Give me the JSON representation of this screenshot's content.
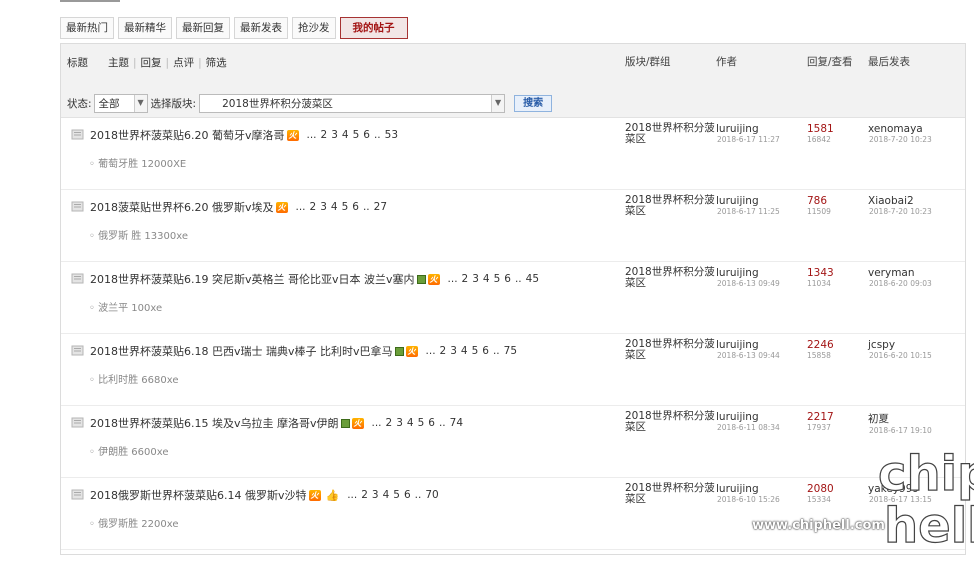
{
  "tabs": [
    "最新热门",
    "最新精华",
    "最新回复",
    "最新发表",
    "抢沙发",
    "我的帖子"
  ],
  "active_tab_index": 5,
  "header": {
    "filters": [
      "标题",
      "主题",
      "回复",
      "点评",
      "筛选"
    ],
    "col_forum": "版块/群组",
    "col_author": "作者",
    "col_stats": "回复/查看",
    "col_last": "最后发表"
  },
  "form": {
    "status_label": "状态:",
    "status_value": "全部",
    "forum_label": "选择版块:",
    "forum_value": "2018世界杯积分菠菜区",
    "search_label": "搜索"
  },
  "threads": [
    {
      "title": "2018世界杯菠菜贴6.20 葡萄牙v摩洛哥",
      "badges": [
        "hot"
      ],
      "pages": [
        "...",
        "2",
        "3",
        "4",
        "5",
        "6",
        "..",
        "53"
      ],
      "sub": "◦ 葡萄牙胜 12000XE",
      "forum": "2018世界杯积分菠菜区",
      "author": "luruijing",
      "author_date": "2018-6-17 11:27",
      "replies": "1581",
      "views": "16842",
      "last_user": "xenomaya",
      "last_date": "2018-7-20 10:23"
    },
    {
      "title": "2018菠菜贴世界杯6.20 俄罗斯v埃及",
      "badges": [
        "hot"
      ],
      "pages": [
        "...",
        "2",
        "3",
        "4",
        "5",
        "6",
        "..",
        "27"
      ],
      "sub": "◦ 俄罗斯 胜 13300xe",
      "forum": "2018世界杯积分菠菜区",
      "author": "luruijing",
      "author_date": "2018-6-17 11:25",
      "replies": "786",
      "views": "11509",
      "last_user": "Xiaobai2",
      "last_date": "2018-7-20 10:23"
    },
    {
      "title": "2018世界杯菠菜贴6.19 突尼斯v英格兰 哥伦比亚v日本 波兰v塞内",
      "badges": [
        "img",
        "hot"
      ],
      "pages": [
        "...",
        "2",
        "3",
        "4",
        "5",
        "6",
        "..",
        "45"
      ],
      "sub": "◦ 波兰平 100xe",
      "forum": "2018世界杯积分菠菜区",
      "author": "luruijing",
      "author_date": "2018-6-13 09:49",
      "replies": "1343",
      "views": "11034",
      "last_user": "veryman",
      "last_date": "2018-6-20 09:03"
    },
    {
      "title": "2018世界杯菠菜贴6.18 巴西v瑞士 瑞典v棒子 比利时v巴拿马",
      "badges": [
        "img",
        "hot"
      ],
      "pages": [
        "...",
        "2",
        "3",
        "4",
        "5",
        "6",
        "..",
        "75"
      ],
      "sub": "◦ 比利时胜 6680xe",
      "forum": "2018世界杯积分菠菜区",
      "author": "luruijing",
      "author_date": "2018-6-13 09:44",
      "replies": "2246",
      "views": "15858",
      "last_user": "jcspy",
      "last_date": "2016-6-20 10:15"
    },
    {
      "title": "2018世界杯菠菜贴6.15 埃及v乌拉圭 摩洛哥v伊朗",
      "badges": [
        "img",
        "hot"
      ],
      "pages": [
        "...",
        "2",
        "3",
        "4",
        "5",
        "6",
        "..",
        "74"
      ],
      "sub": "◦ 伊朗胜 6600xe",
      "forum": "2018世界杯积分菠菜区",
      "author": "luruijing",
      "author_date": "2018-6-11 08:34",
      "replies": "2217",
      "views": "17937",
      "last_user": "初夏",
      "last_date": "2018-6-17 19:10"
    },
    {
      "title": "2018俄罗斯世界杯菠菜贴6.14 俄罗斯v沙特",
      "badges": [
        "hot",
        "thumb"
      ],
      "pages": [
        "...",
        "2",
        "3",
        "4",
        "5",
        "6",
        "..",
        "70"
      ],
      "sub": "◦ 俄罗斯胜 2200xe",
      "forum": "2018世界杯积分菠菜区",
      "author": "luruijing",
      "author_date": "2018-6-10 15:26",
      "replies": "2080",
      "views": "15334",
      "last_user": "yakey999",
      "last_date": "2018-6-17 13:15"
    }
  ],
  "watermark": {
    "site": "www.chiphell.com",
    "logo_top": "chip",
    "logo_bottom": "hell"
  },
  "colors": {
    "accent_red": "#a31515",
    "header_bg": "#f2f2f2",
    "hot_badge": "#ff8a00"
  }
}
